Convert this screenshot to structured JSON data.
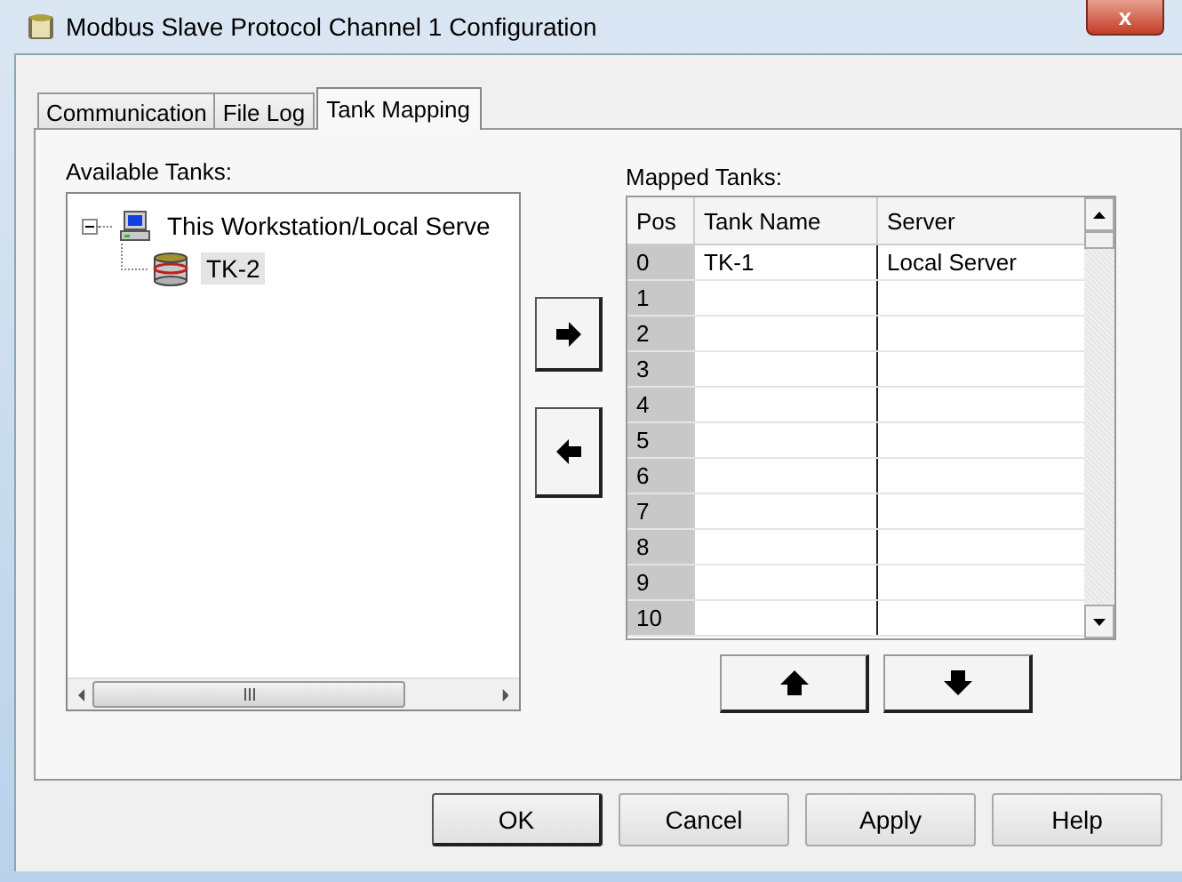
{
  "window": {
    "title": "Modbus Slave Protocol Channel 1 Configuration",
    "close": "x"
  },
  "tabs": [
    {
      "label": "Communication",
      "selected": false
    },
    {
      "label": "File Log",
      "selected": false
    },
    {
      "label": "Tank Mapping",
      "selected": true
    }
  ],
  "available": {
    "label": "Available Tanks:",
    "tree": [
      {
        "label": "This Workstation/Local Serve",
        "kind": "workstation",
        "expanded": true,
        "selected": false,
        "children": [
          {
            "label": "TK-2",
            "kind": "tank",
            "selected": true
          }
        ]
      }
    ]
  },
  "mapped": {
    "label": "Mapped Tanks:",
    "columns": [
      "Pos",
      "Tank Name",
      "Server"
    ],
    "rows": [
      [
        "0",
        "TK-1",
        "Local Server"
      ],
      [
        "1",
        "",
        ""
      ],
      [
        "2",
        "",
        ""
      ],
      [
        "3",
        "",
        ""
      ],
      [
        "4",
        "",
        ""
      ],
      [
        "5",
        "",
        ""
      ],
      [
        "6",
        "",
        ""
      ],
      [
        "7",
        "",
        ""
      ],
      [
        "8",
        "",
        ""
      ],
      [
        "9",
        "",
        ""
      ],
      [
        "10",
        "",
        ""
      ]
    ]
  },
  "buttons": [
    "OK",
    "Cancel",
    "Apply",
    "Help"
  ]
}
